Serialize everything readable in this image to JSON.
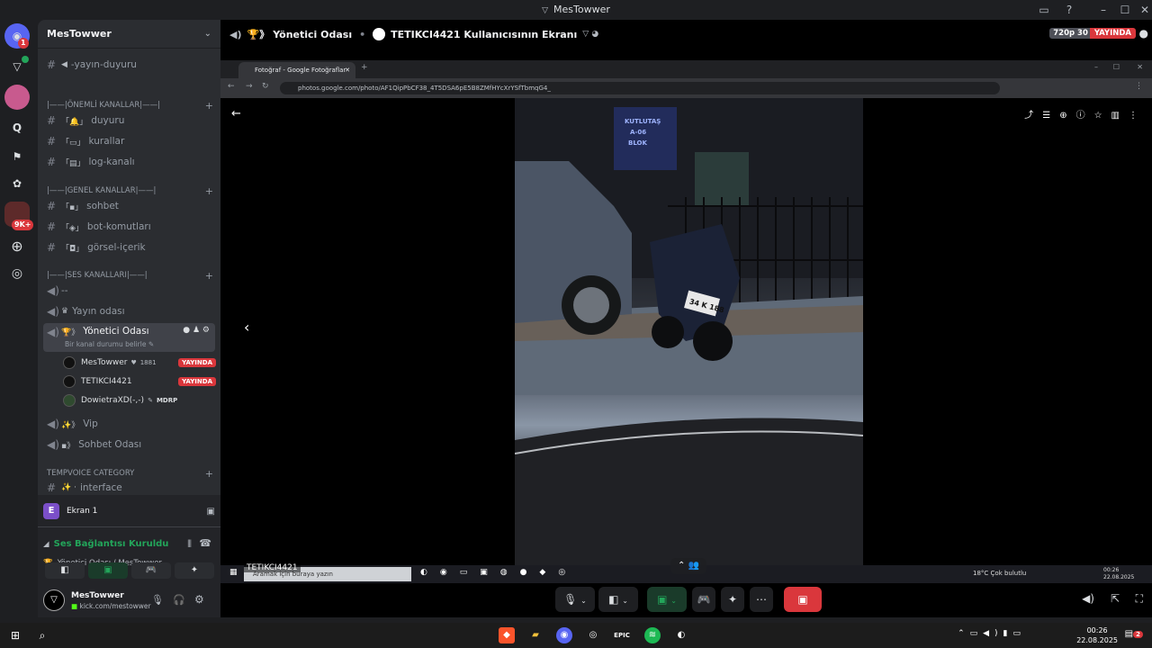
{
  "window": {
    "title": "MesTowwer"
  },
  "rail": {
    "badges": {
      "home": "1",
      "server_count": "9K+"
    }
  },
  "server": {
    "name": "MesTowwer"
  },
  "channels": {
    "yayin_duyuru": "-yayın-duyuru",
    "cat_onemli": "|——|ÖNEMLİ KANALLAR|——|",
    "duyuru": "duyuru",
    "kurallar": "kurallar",
    "log": "log-kanalı",
    "cat_genel": "|——|GENEL KANALLAR|——|",
    "sohbet": "sohbet",
    "bot": "bot-komutları",
    "gorsel": "görsel-içerik",
    "cat_ses": "|——|SES KANALLARI|——|",
    "dash": "--",
    "yayin_odasi": "Yayın odası",
    "yonetici": "Yönetici Odası",
    "status_hint": "Bir kanal durumu belirle",
    "vip": "Vip",
    "sohbet_odasi": "Sohbet Odası",
    "cat_temp": "TEMPVOICE CATEGORY",
    "interface": "interface"
  },
  "voice_users": [
    {
      "name": "MesTowwer",
      "extra": "1881",
      "live": "YAYINDA"
    },
    {
      "name": "TETIKCI4421",
      "extra": "",
      "live": "YAYINDA"
    },
    {
      "name": "DowietraXD(-,-)",
      "extra": "MDRP",
      "live": ""
    }
  ],
  "panel": {
    "screen": "Ekran 1",
    "screen_initial": "E",
    "connected": "Ses Bağlantısı Kuruldu",
    "location": "Yönetici Odası / MesTowwer",
    "user_name": "MesTowwer",
    "user_status": "kick.com/mestowwer"
  },
  "main": {
    "channel": "Yönetici Odası",
    "stream_title": "TETIKCI4421 Kullanıcısının Ekranı",
    "quality": "720p 30 FPS",
    "live": "YAYINDA"
  },
  "stream": {
    "tab_title": "Fotoğraf - Google Fotoğraflar",
    "url": "photos.google.com/photo/AF1QipPbCF38_4T5DSA6pE5B8ZMfHYcXrYSfTbmqG4_",
    "search_placeholder": "Aramak için buraya yazın",
    "overlay_name": "TETIKCI4421",
    "weather": "18°C Çok bulutlu",
    "inner_time": "00:26",
    "inner_date": "22.08.2025",
    "sign_text": "KUTLUTAŞ A-06 BLOK",
    "plate": "34 K 188"
  },
  "taskbar": {
    "time": "00:26",
    "date": "22.08.2025",
    "notif": "2"
  }
}
